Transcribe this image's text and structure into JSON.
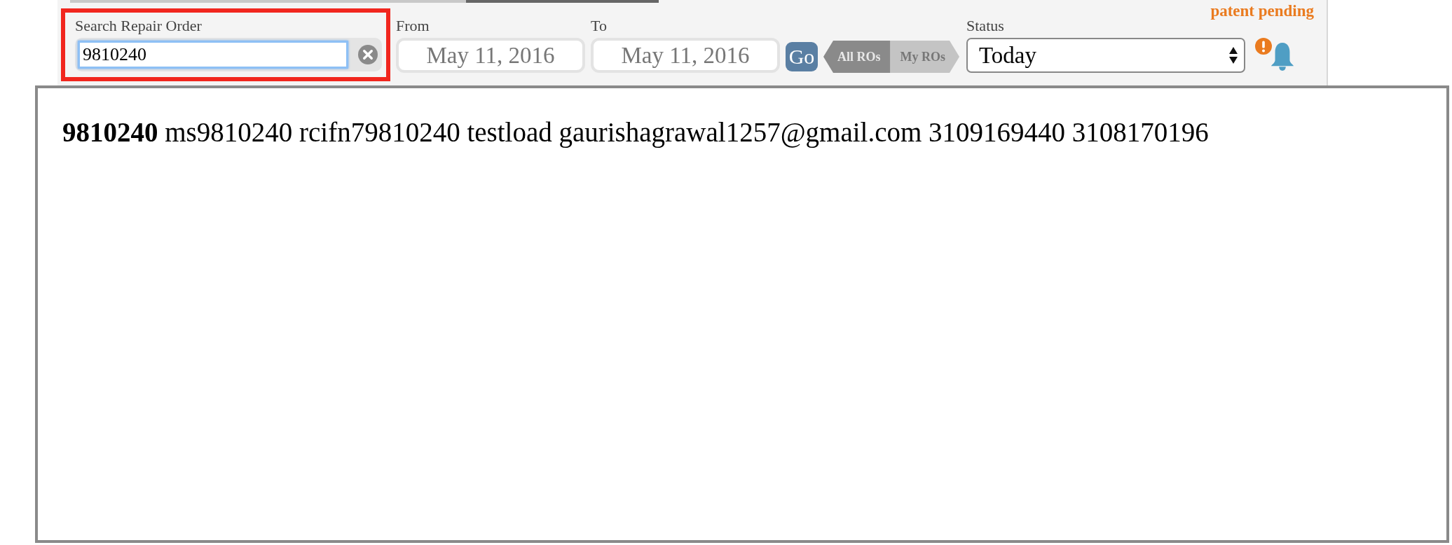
{
  "search": {
    "label": "Search Repair Order",
    "value": "9810240",
    "focused": true,
    "highlighted": true
  },
  "from": {
    "label": "From",
    "value": "May 11, 2016"
  },
  "to": {
    "label": "To",
    "value": "May 11, 2016"
  },
  "go_button": "Go",
  "ro_toggle": [
    {
      "label": "All ROs",
      "selected": true
    },
    {
      "label": "My ROs",
      "selected": false
    }
  ],
  "status": {
    "label": "Status",
    "value": "Today"
  },
  "notice": "patent pending",
  "results": [
    "**9810240** ms9810240 rcifn79810240 testload gaurishagrawal1257@gmail.com 3109169440 3108170196"
  ]
}
